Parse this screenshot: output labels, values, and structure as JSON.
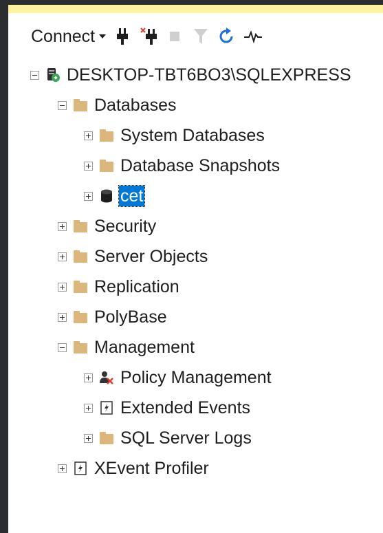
{
  "toolbar": {
    "connect_label": "Connect",
    "icons": [
      "connect-plug-icon",
      "disconnect-plug-icon",
      "stop-icon",
      "filter-icon",
      "refresh-icon",
      "activity-monitor-icon"
    ]
  },
  "tree": {
    "server": "DESKTOP-TBT6BO3\\SQLEXPRESS",
    "databases": "Databases",
    "system_databases": "System Databases",
    "database_snapshots": "Database Snapshots",
    "cet": "cet",
    "security": "Security",
    "server_objects": "Server Objects",
    "replication": "Replication",
    "polybase": "PolyBase",
    "management": "Management",
    "policy_management": "Policy Management",
    "extended_events": "Extended Events",
    "sql_server_logs": "SQL Server Logs",
    "xevent_profiler": "XEvent Profiler"
  },
  "colors": {
    "folder": "#dcb67a",
    "selection": "#0078d7",
    "refresh": "#1e6fd9",
    "error_x": "#e03c31"
  }
}
